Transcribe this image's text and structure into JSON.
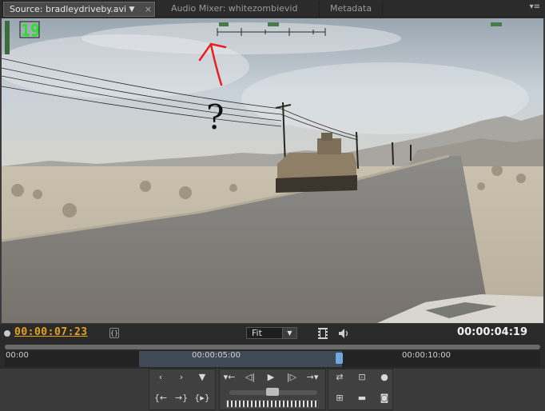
{
  "tabs": [
    {
      "label": "Source: bradleydriveby.avi",
      "active": true
    },
    {
      "label": "Audio Mixer: whitezombievid",
      "active": false
    },
    {
      "label": "Metadata",
      "active": false
    }
  ],
  "video": {
    "hud_number": "19",
    "annotation_mark": "?"
  },
  "info": {
    "current_timecode": "00:00:07:23",
    "duration_timecode": "00:00:04:19",
    "zoom_select": "Fit"
  },
  "ruler": {
    "ticks": [
      "00:00",
      "00:00:05:00",
      "00:00:10:00"
    ]
  },
  "icons": {
    "close": "close-icon",
    "dropdown": "chevron-down-icon",
    "panel_menu": "panel-menu-icon",
    "film": "film-icon",
    "speaker": "speaker-icon"
  },
  "colors": {
    "timecode_orange": "#e6a21a",
    "annotation_red": "#e82020",
    "selection_blue": "#3f4a56"
  }
}
